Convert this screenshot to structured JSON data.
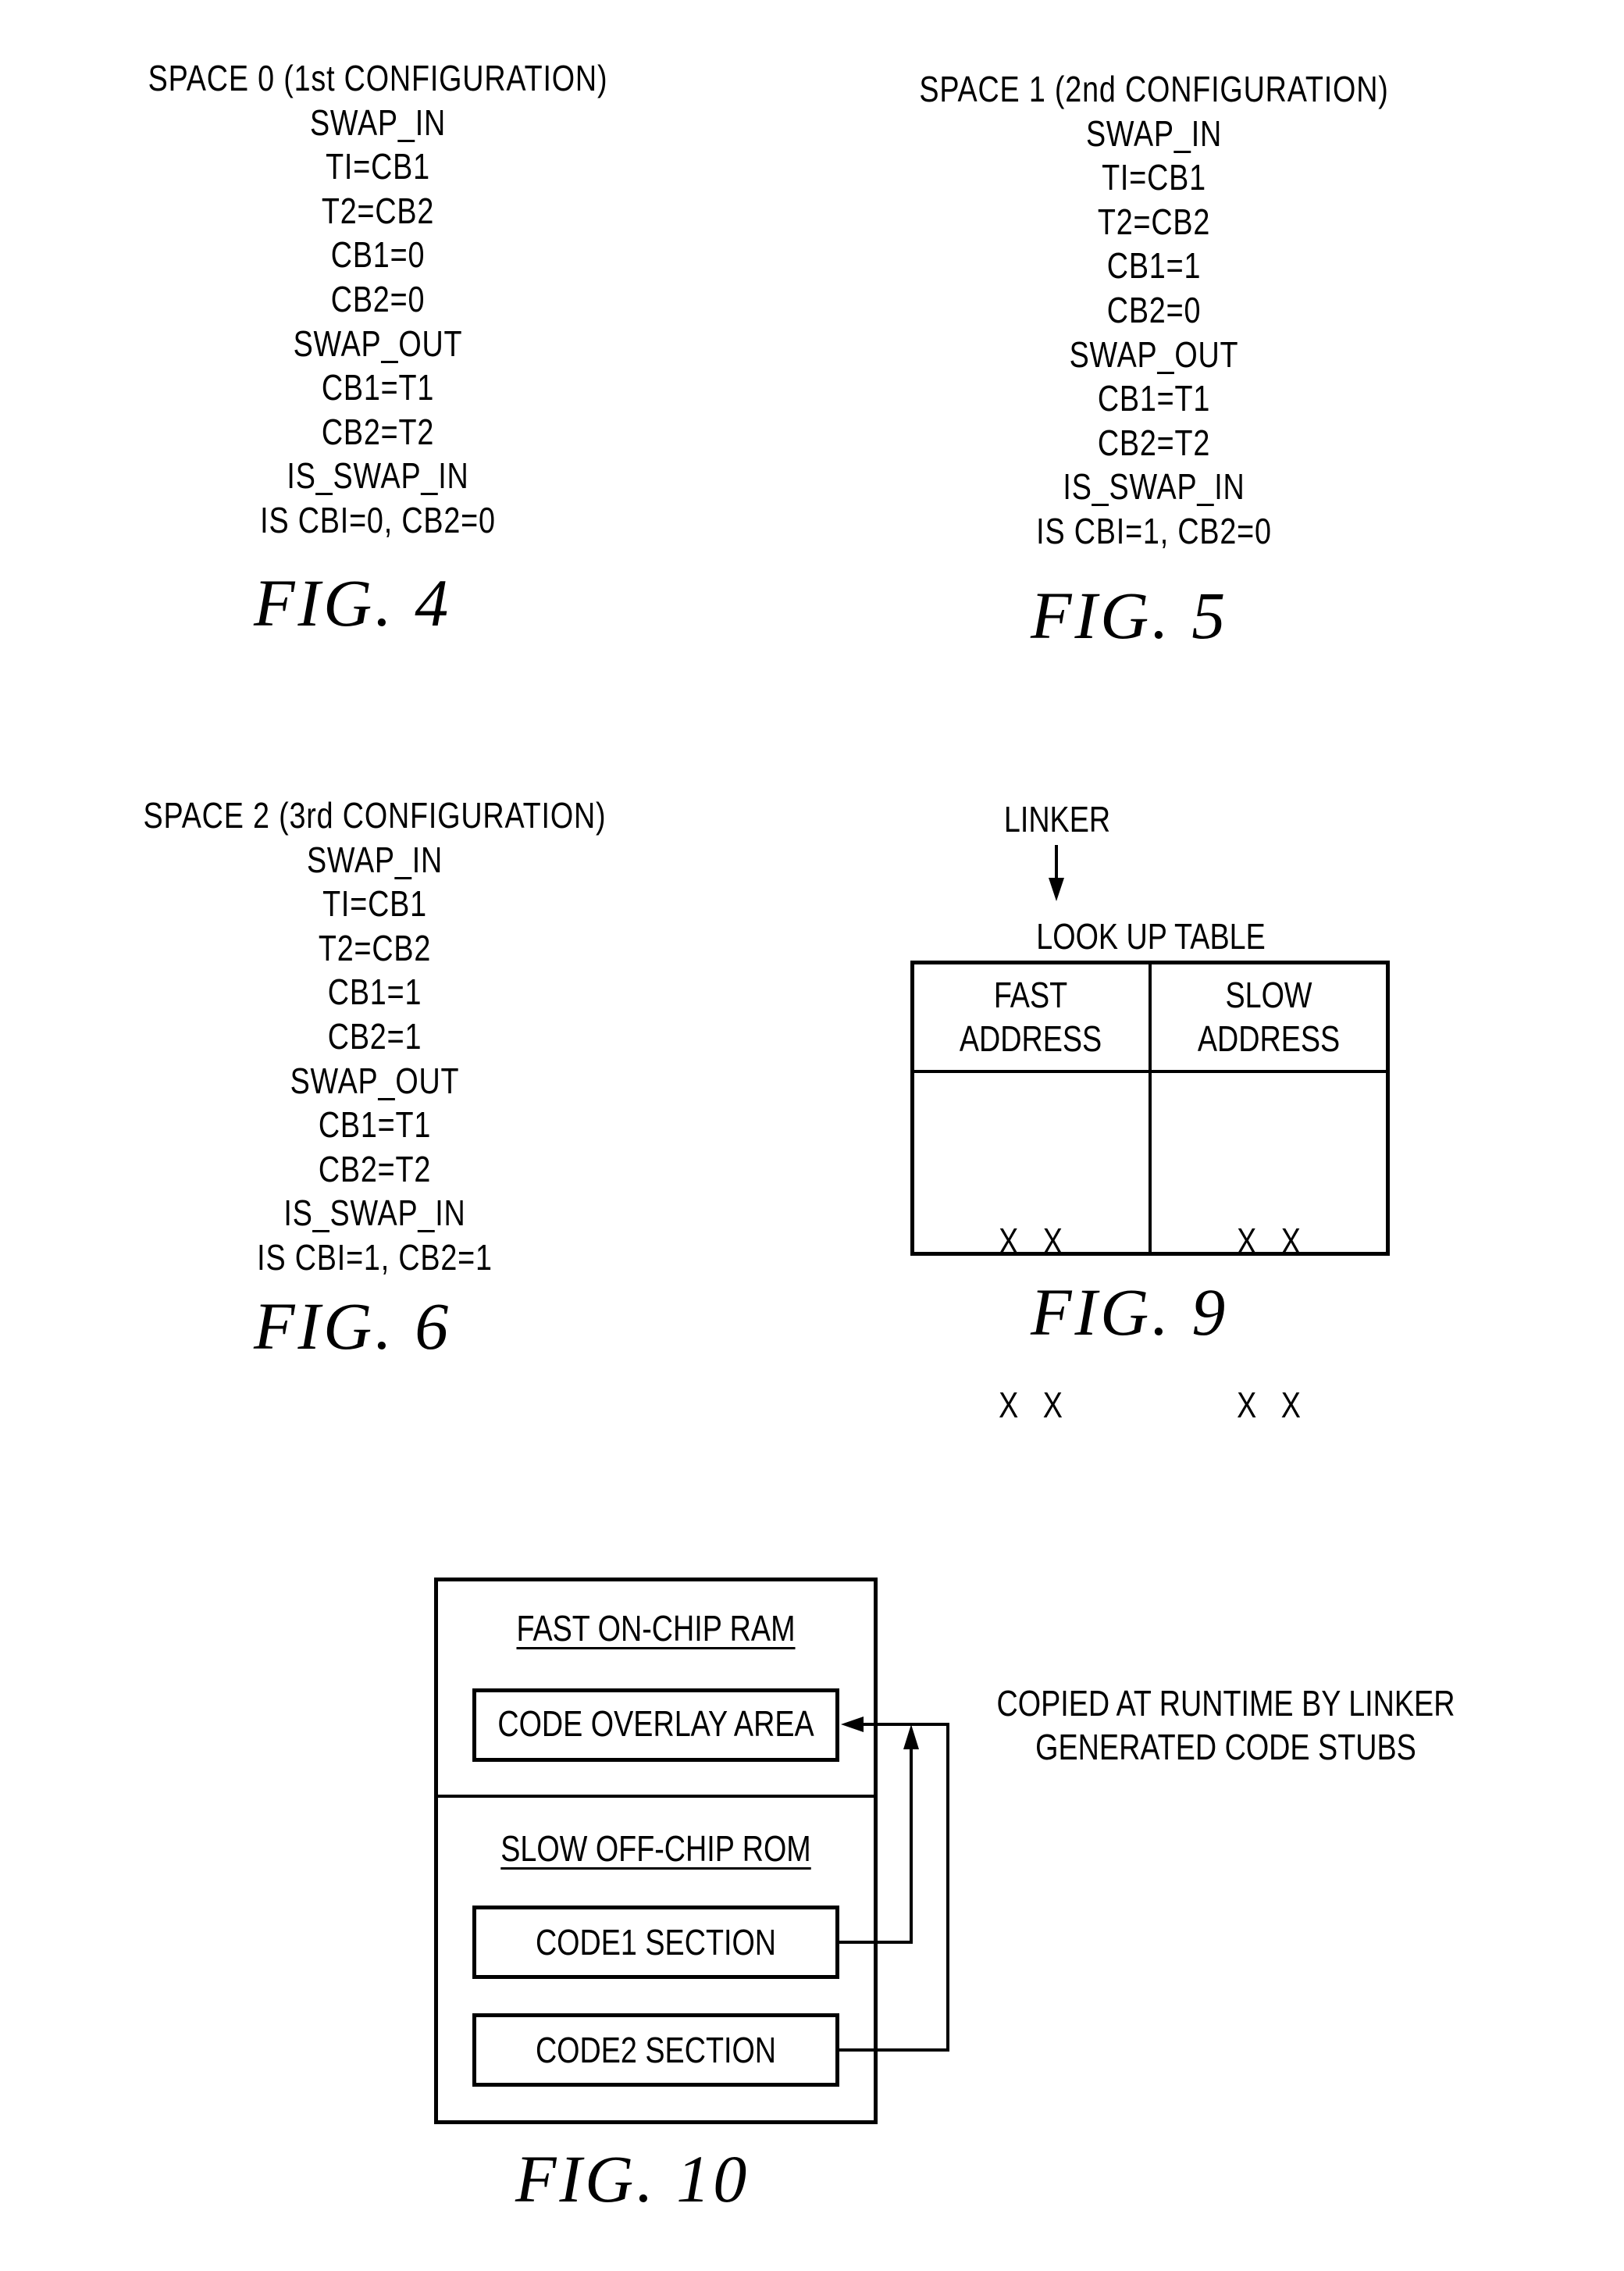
{
  "figures": {
    "fig4": {
      "caption": "FIG. 4",
      "lines": [
        "SPACE 0 (1st CONFIGURATION)",
        "SWAP_IN",
        "TI=CB1",
        "T2=CB2",
        "CB1=0",
        "CB2=0",
        "SWAP_OUT",
        "CB1=T1",
        "CB2=T2",
        "IS_SWAP_IN",
        "IS CBI=0, CB2=0"
      ]
    },
    "fig5": {
      "caption": "FIG. 5",
      "lines": [
        "SPACE 1 (2nd CONFIGURATION)",
        "SWAP_IN",
        "TI=CB1",
        "T2=CB2",
        "CB1=1",
        "CB2=0",
        "SWAP_OUT",
        "CB1=T1",
        "CB2=T2",
        "IS_SWAP_IN",
        "IS CBI=1, CB2=0"
      ]
    },
    "fig6": {
      "caption": "FIG. 6",
      "lines": [
        "SPACE 2 (3rd CONFIGURATION)",
        "SWAP_IN",
        "TI=CB1",
        "T2=CB2",
        "CB1=1",
        "CB2=1",
        "SWAP_OUT",
        "CB1=T1",
        "CB2=T2",
        "IS_SWAP_IN",
        "IS CBI=1, CB2=1"
      ]
    },
    "fig9": {
      "caption": "FIG. 9",
      "linker_label": "LINKER",
      "table_title": "LOOK UP TABLE",
      "columns": [
        {
          "header_line1": "FAST",
          "header_line2": "ADDRESS",
          "rows": [
            "X   X",
            "X   X"
          ]
        },
        {
          "header_line1": "SLOW",
          "header_line2": "ADDRESS",
          "rows": [
            "X   X",
            "X   X"
          ]
        }
      ]
    },
    "fig10": {
      "caption": "FIG. 10",
      "ram_title": "FAST ON-CHIP RAM",
      "overlay_area": "CODE OVERLAY AREA",
      "rom_title": "SLOW OFF-CHIP ROM",
      "code1": "CODE1 SECTION",
      "code2": "CODE2 SECTION",
      "note_line1": "COPIED AT RUNTIME BY LINKER",
      "note_line2": "GENERATED CODE STUBS"
    }
  }
}
